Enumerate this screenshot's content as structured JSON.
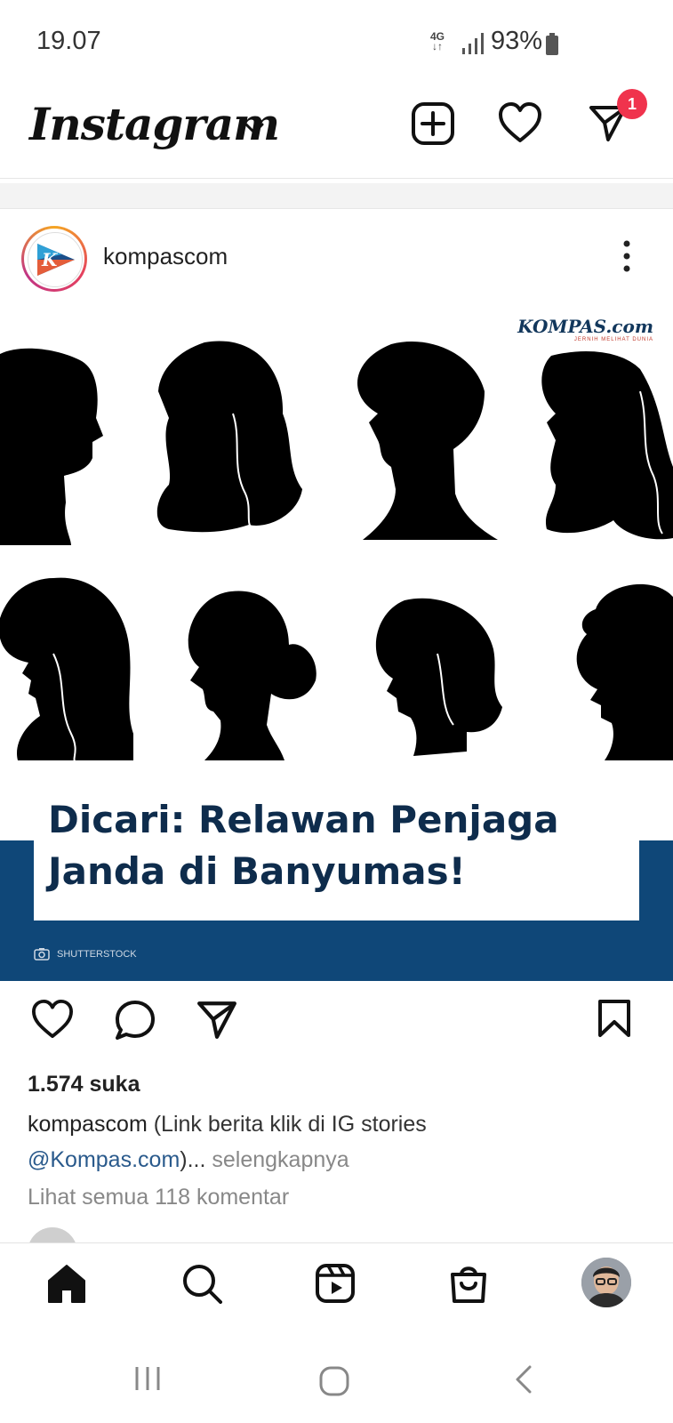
{
  "status_bar": {
    "time": "19.07",
    "network": "4G",
    "battery": "93%"
  },
  "header": {
    "app_title": "Instagram",
    "notification_count": "1"
  },
  "post": {
    "username": "kompascom",
    "image": {
      "brand": "KOMPAS.com",
      "brand_tagline": "JERNIH MELIHAT DUNIA",
      "headline_line1": "Dicari: Relawan Penjaga",
      "headline_line2": "Janda di Banyumas!",
      "credit": "SHUTTERSTOCK"
    },
    "likes": "1.574 suka",
    "caption_user": "kompascom",
    "caption_text": " (Link berita klik di IG stories",
    "caption_mention": "@Kompas.com",
    "caption_tail": ")...",
    "caption_more": " selengkapnya",
    "comments_link": "Lihat semua 118 komentar"
  },
  "icons": {
    "header": [
      "chevron-down-icon",
      "add-post-icon",
      "heart-icon",
      "direct-message-icon"
    ],
    "post_actions": [
      "heart-icon",
      "comment-icon",
      "share-icon",
      "bookmark-icon"
    ],
    "bottom_nav": [
      "home-icon",
      "search-icon",
      "reels-icon",
      "shop-icon",
      "profile-avatar"
    ],
    "system": [
      "recent-apps-icon",
      "home-circle-icon",
      "back-icon"
    ]
  }
}
